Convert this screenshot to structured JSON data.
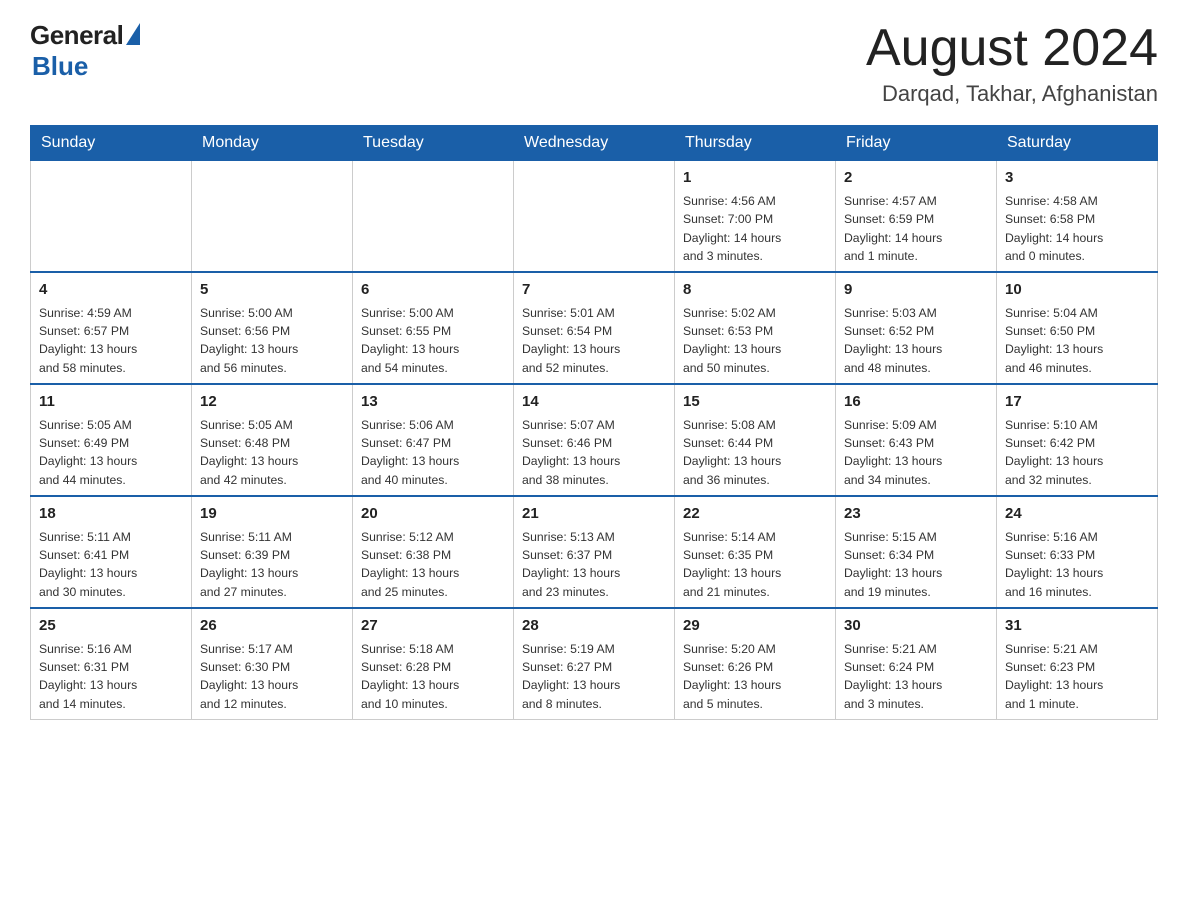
{
  "logo": {
    "general": "General",
    "blue": "Blue"
  },
  "title": "August 2024",
  "location": "Darqad, Takhar, Afghanistan",
  "days_header": [
    "Sunday",
    "Monday",
    "Tuesday",
    "Wednesday",
    "Thursday",
    "Friday",
    "Saturday"
  ],
  "weeks": [
    [
      {
        "day": "",
        "info": ""
      },
      {
        "day": "",
        "info": ""
      },
      {
        "day": "",
        "info": ""
      },
      {
        "day": "",
        "info": ""
      },
      {
        "day": "1",
        "info": "Sunrise: 4:56 AM\nSunset: 7:00 PM\nDaylight: 14 hours\nand 3 minutes."
      },
      {
        "day": "2",
        "info": "Sunrise: 4:57 AM\nSunset: 6:59 PM\nDaylight: 14 hours\nand 1 minute."
      },
      {
        "day": "3",
        "info": "Sunrise: 4:58 AM\nSunset: 6:58 PM\nDaylight: 14 hours\nand 0 minutes."
      }
    ],
    [
      {
        "day": "4",
        "info": "Sunrise: 4:59 AM\nSunset: 6:57 PM\nDaylight: 13 hours\nand 58 minutes."
      },
      {
        "day": "5",
        "info": "Sunrise: 5:00 AM\nSunset: 6:56 PM\nDaylight: 13 hours\nand 56 minutes."
      },
      {
        "day": "6",
        "info": "Sunrise: 5:00 AM\nSunset: 6:55 PM\nDaylight: 13 hours\nand 54 minutes."
      },
      {
        "day": "7",
        "info": "Sunrise: 5:01 AM\nSunset: 6:54 PM\nDaylight: 13 hours\nand 52 minutes."
      },
      {
        "day": "8",
        "info": "Sunrise: 5:02 AM\nSunset: 6:53 PM\nDaylight: 13 hours\nand 50 minutes."
      },
      {
        "day": "9",
        "info": "Sunrise: 5:03 AM\nSunset: 6:52 PM\nDaylight: 13 hours\nand 48 minutes."
      },
      {
        "day": "10",
        "info": "Sunrise: 5:04 AM\nSunset: 6:50 PM\nDaylight: 13 hours\nand 46 minutes."
      }
    ],
    [
      {
        "day": "11",
        "info": "Sunrise: 5:05 AM\nSunset: 6:49 PM\nDaylight: 13 hours\nand 44 minutes."
      },
      {
        "day": "12",
        "info": "Sunrise: 5:05 AM\nSunset: 6:48 PM\nDaylight: 13 hours\nand 42 minutes."
      },
      {
        "day": "13",
        "info": "Sunrise: 5:06 AM\nSunset: 6:47 PM\nDaylight: 13 hours\nand 40 minutes."
      },
      {
        "day": "14",
        "info": "Sunrise: 5:07 AM\nSunset: 6:46 PM\nDaylight: 13 hours\nand 38 minutes."
      },
      {
        "day": "15",
        "info": "Sunrise: 5:08 AM\nSunset: 6:44 PM\nDaylight: 13 hours\nand 36 minutes."
      },
      {
        "day": "16",
        "info": "Sunrise: 5:09 AM\nSunset: 6:43 PM\nDaylight: 13 hours\nand 34 minutes."
      },
      {
        "day": "17",
        "info": "Sunrise: 5:10 AM\nSunset: 6:42 PM\nDaylight: 13 hours\nand 32 minutes."
      }
    ],
    [
      {
        "day": "18",
        "info": "Sunrise: 5:11 AM\nSunset: 6:41 PM\nDaylight: 13 hours\nand 30 minutes."
      },
      {
        "day": "19",
        "info": "Sunrise: 5:11 AM\nSunset: 6:39 PM\nDaylight: 13 hours\nand 27 minutes."
      },
      {
        "day": "20",
        "info": "Sunrise: 5:12 AM\nSunset: 6:38 PM\nDaylight: 13 hours\nand 25 minutes."
      },
      {
        "day": "21",
        "info": "Sunrise: 5:13 AM\nSunset: 6:37 PM\nDaylight: 13 hours\nand 23 minutes."
      },
      {
        "day": "22",
        "info": "Sunrise: 5:14 AM\nSunset: 6:35 PM\nDaylight: 13 hours\nand 21 minutes."
      },
      {
        "day": "23",
        "info": "Sunrise: 5:15 AM\nSunset: 6:34 PM\nDaylight: 13 hours\nand 19 minutes."
      },
      {
        "day": "24",
        "info": "Sunrise: 5:16 AM\nSunset: 6:33 PM\nDaylight: 13 hours\nand 16 minutes."
      }
    ],
    [
      {
        "day": "25",
        "info": "Sunrise: 5:16 AM\nSunset: 6:31 PM\nDaylight: 13 hours\nand 14 minutes."
      },
      {
        "day": "26",
        "info": "Sunrise: 5:17 AM\nSunset: 6:30 PM\nDaylight: 13 hours\nand 12 minutes."
      },
      {
        "day": "27",
        "info": "Sunrise: 5:18 AM\nSunset: 6:28 PM\nDaylight: 13 hours\nand 10 minutes."
      },
      {
        "day": "28",
        "info": "Sunrise: 5:19 AM\nSunset: 6:27 PM\nDaylight: 13 hours\nand 8 minutes."
      },
      {
        "day": "29",
        "info": "Sunrise: 5:20 AM\nSunset: 6:26 PM\nDaylight: 13 hours\nand 5 minutes."
      },
      {
        "day": "30",
        "info": "Sunrise: 5:21 AM\nSunset: 6:24 PM\nDaylight: 13 hours\nand 3 minutes."
      },
      {
        "day": "31",
        "info": "Sunrise: 5:21 AM\nSunset: 6:23 PM\nDaylight: 13 hours\nand 1 minute."
      }
    ]
  ]
}
